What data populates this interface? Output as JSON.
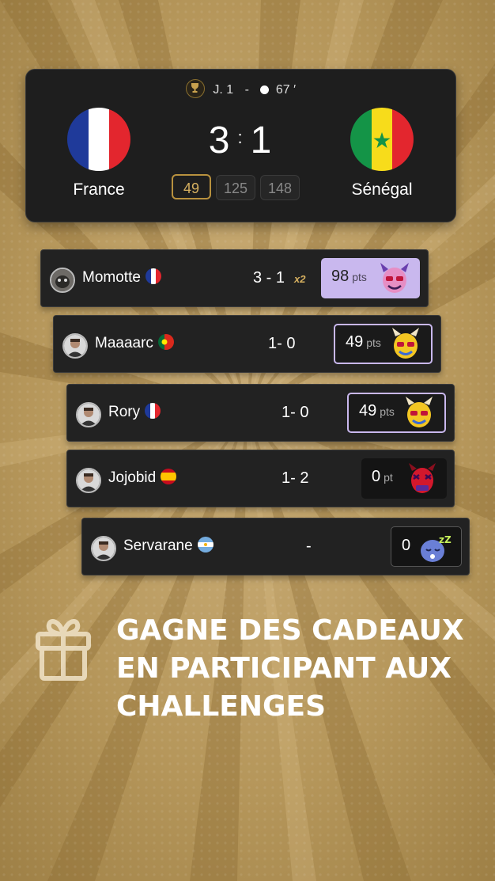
{
  "match": {
    "round": "J. 1",
    "separator": "-",
    "minute": "67 ′",
    "home": {
      "name": "France",
      "flag": "flag-france"
    },
    "away": {
      "name": "Sénégal",
      "flag": "flag-senegal"
    },
    "home_score": "3",
    "score_sep": ":",
    "away_score": "1",
    "pills": [
      "49",
      "125",
      "148"
    ],
    "active_pill": 0
  },
  "predictions": [
    {
      "user": "Momotte",
      "flag": "flag-france",
      "prediction": "3 - 1",
      "multiplier": "x2",
      "points": "98",
      "unit": "pts",
      "style": "filled",
      "mascot": "mascot-demon-pink-icon"
    },
    {
      "user": "Maaaarc",
      "flag": "flag-portugal",
      "prediction": "1- 0",
      "multiplier": "",
      "points": "49",
      "unit": "pts",
      "style": "outlined",
      "mascot": "mascot-yellow-horned-icon"
    },
    {
      "user": "Rory",
      "flag": "flag-france",
      "prediction": "1- 0",
      "multiplier": "",
      "points": "49",
      "unit": "pts",
      "style": "outlined",
      "mascot": "mascot-yellow-horned-icon"
    },
    {
      "user": "Jojobid",
      "flag": "flag-spain",
      "prediction": "1- 2",
      "multiplier": "",
      "points": "0",
      "unit": "pt",
      "style": "dark",
      "mascot": "mascot-red-devil-icon"
    },
    {
      "user": "Servarane",
      "flag": "flag-argentina",
      "prediction": "-",
      "multiplier": "",
      "points": "0",
      "unit": "",
      "style": "dark",
      "mascot": "mascot-sleeping-blue-icon"
    }
  ],
  "promo": {
    "icon": "gift-icon",
    "line1": "GAGNE DES CADEAUX",
    "line2": "EN PARTICIPANT AUX",
    "line3": "CHALLENGES"
  },
  "colors": {
    "gold": "#d7b160",
    "card": "#1e1e1e",
    "lavender": "#c9b8ee",
    "background": "#b89a5e"
  }
}
